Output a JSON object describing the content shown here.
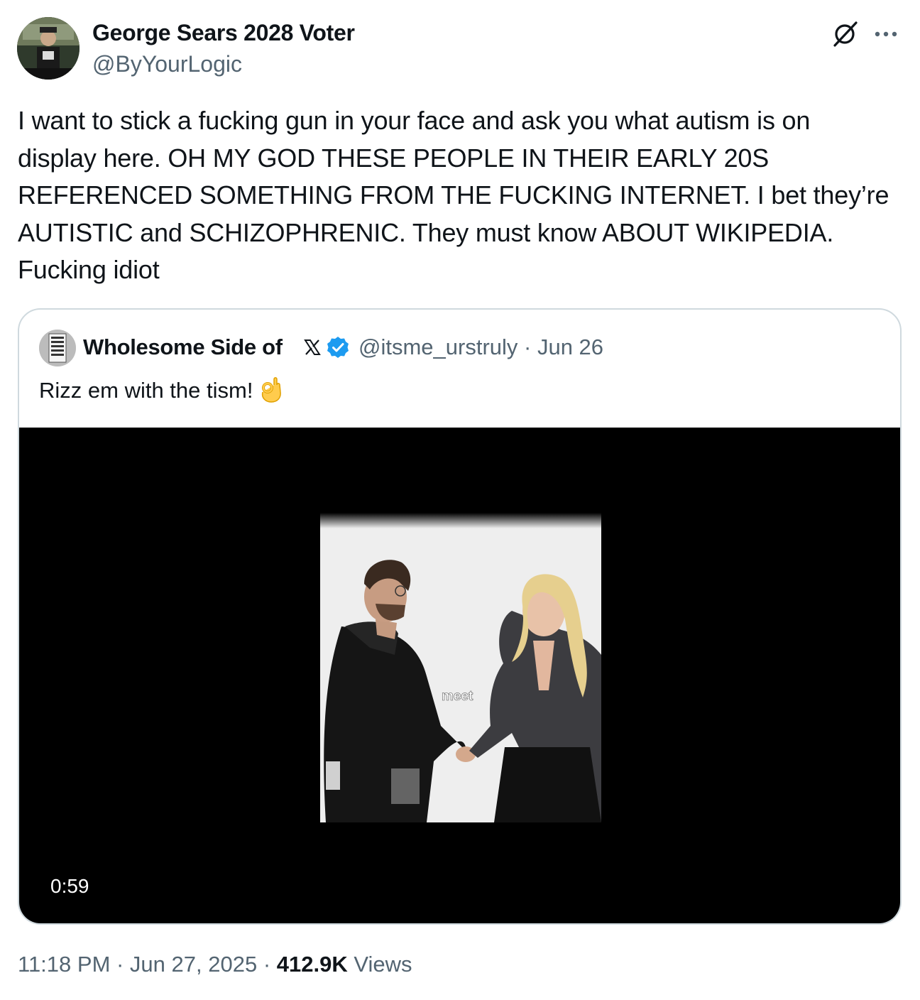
{
  "author": {
    "name": "George Sears 2028 Voter",
    "handle": "@ByYourLogic"
  },
  "tweet": {
    "text": "I want to stick a fucking gun in your face and ask you what autism is on\ndisplay here. OH MY GOD THESE PEOPLE IN THEIR EARLY 20S\nREFERENCED SOMETHING FROM THE FUCKING INTERNET. I bet they’re\nAUTISTIC and SCHIZOPHRENIC. They must know ABOUT WIKIPEDIA.\nFucking idiot"
  },
  "quote": {
    "name": "Wholesome Side of",
    "handle_date": "@itsme_urstruly · Jun 26",
    "text": "Rizz em with the tism!",
    "video": {
      "duration": "0:59",
      "caption": "meet"
    }
  },
  "footer": {
    "time_date": "11:18 PM · Jun 27, 2025 · ",
    "views_count": "412.9K",
    "views_label": " Views"
  },
  "icons": {
    "grok": "grok-icon",
    "more": "more-icon",
    "x_logo": "x-logo-icon",
    "verified": "verified-badge-icon",
    "ok_hand": "ok-hand-emoji"
  },
  "colors": {
    "text": "#0f1419",
    "secondary": "#536471",
    "verified": "#1d9bf0",
    "border": "#cfd9de"
  }
}
